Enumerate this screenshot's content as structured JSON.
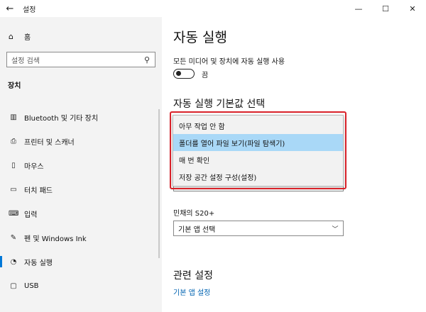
{
  "window": {
    "title": "설정",
    "back_icon": "back-arrow-icon",
    "minimize_glyph": "—",
    "maximize_glyph": "☐",
    "close_glyph": "✕"
  },
  "sidebar": {
    "home": {
      "label": "홈",
      "icon": "home-icon"
    },
    "search": {
      "placeholder": "설정 검색",
      "icon": "search-icon"
    },
    "section_title": "장치",
    "items": [
      {
        "label": "Bluetooth 및 기타 장치",
        "icon": "bluetooth-device-icon",
        "active": false
      },
      {
        "label": "프린터 및 스캐너",
        "icon": "printer-icon",
        "active": false
      },
      {
        "label": "마우스",
        "icon": "mouse-icon",
        "active": false
      },
      {
        "label": "터치 패드",
        "icon": "touchpad-icon",
        "active": false
      },
      {
        "label": "입력",
        "icon": "keyboard-icon",
        "active": false
      },
      {
        "label": "펜 및 Windows Ink",
        "icon": "pen-icon",
        "active": false
      },
      {
        "label": "자동 실행",
        "icon": "autoplay-icon",
        "active": true
      },
      {
        "label": "USB",
        "icon": "usb-icon",
        "active": false
      }
    ]
  },
  "main": {
    "title": "자동 실행",
    "toggle_label": "모든 미디어 및 장치에 자동 실행 사용",
    "toggle_state": "끔",
    "toggle_on": false,
    "defaults_title": "자동 실행 기본값 선택",
    "dropdown_options": [
      {
        "label": "아무 작업 안 함",
        "selected": false
      },
      {
        "label": "폴더를 열어 파일 보기(파일 탐색기)",
        "selected": true
      },
      {
        "label": "매 번 확인",
        "selected": false
      },
      {
        "label": "저장 공간 설정 구성(설정)",
        "selected": false
      }
    ],
    "device_label": "민채의 S20+",
    "device_select_value": "기본 앱 선택",
    "related_title": "관련 설정",
    "related_link": "기본 앱 설정"
  },
  "colors": {
    "accent": "#0078d7",
    "link": "#0063b1",
    "highlight_border": "#d9222a",
    "selected_option": "#a9d8f7"
  }
}
